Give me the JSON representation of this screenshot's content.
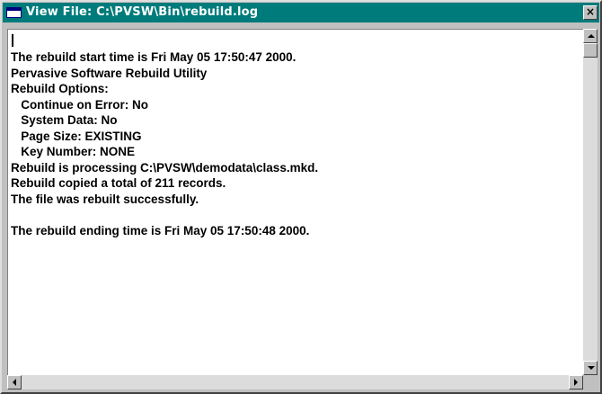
{
  "window": {
    "title": "View File: C:\\PVSW\\Bin\\rebuild.log",
    "close_glyph": "×",
    "title_bar_color": "#007b7b",
    "icons": {
      "system_menu": "window-icon",
      "close": "close-icon"
    }
  },
  "log": {
    "lines": [
      "The rebuild start time is Fri May 05 17:50:47 2000.",
      "Pervasive Software Rebuild Utility",
      "Rebuild Options:",
      "   Continue on Error: No",
      "   System Data: No",
      "   Page Size: EXISTING",
      "   Key Number: NONE",
      "Rebuild is processing C:\\PVSW\\demodata\\class.mkd.",
      "Rebuild copied a total of 211 records.",
      "The file was rebuilt successfully.",
      "",
      "The rebuild ending time is Fri May 05 17:50:48 2000."
    ]
  },
  "scrollbars": {
    "icons": {
      "up": "scroll-up-arrow-icon",
      "down": "scroll-down-arrow-icon",
      "left": "scroll-left-arrow-icon",
      "right": "scroll-right-arrow-icon"
    }
  }
}
